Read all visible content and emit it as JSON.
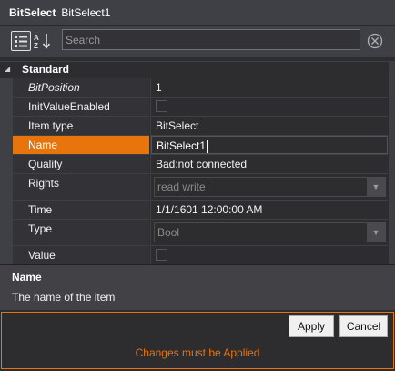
{
  "title": {
    "type": "BitSelect",
    "name": "BitSelect1"
  },
  "toolbar": {
    "search_placeholder": "Search",
    "categorized_icon": "categorized-view-icon",
    "alphabetical_icon": "sort-alphabetical-icon",
    "clear_icon": "clear-search-icon"
  },
  "category": {
    "label": "Standard"
  },
  "rows": [
    {
      "name": "BitPosition",
      "value": "1"
    },
    {
      "name": "InitValueEnabled",
      "value": ""
    },
    {
      "name": "Item type",
      "value": "BitSelect"
    },
    {
      "name": "Name",
      "value": "BitSelect1"
    },
    {
      "name": "Quality",
      "value": "Bad:not connected"
    },
    {
      "name": "Rights",
      "value": "read write"
    },
    {
      "name": "Time",
      "value": "1/1/1601 12:00:00 AM"
    },
    {
      "name": "Type",
      "value": "Bool"
    },
    {
      "name": "Value",
      "value": ""
    }
  ],
  "description": {
    "title": "Name",
    "text": "The name of the item"
  },
  "actions": {
    "apply": "Apply",
    "cancel": "Cancel",
    "message": "Changes must be Applied"
  },
  "colors": {
    "accent": "#e8740c",
    "background": "#2d2d30",
    "header": "#3f3f46"
  }
}
